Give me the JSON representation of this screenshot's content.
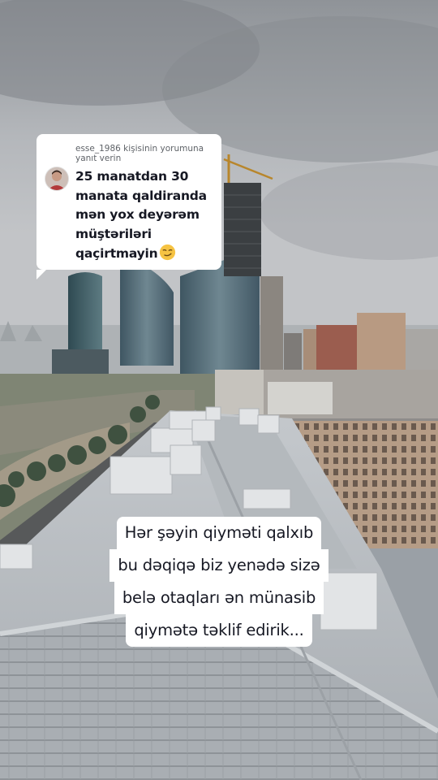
{
  "reply": {
    "header": "esse_1986 kişisinin yorumuna yanıt verin",
    "lines": [
      "25 manatdan 30",
      "manata qaldiranda",
      "mən yox deyərəm",
      "müştəriləri",
      "qaçirtmayin"
    ],
    "emoji_icon": "smirking-face-emoji"
  },
  "caption": {
    "lines": [
      "Hər şəyin qiyməti qalxıb",
      "bu dəqiqə biz yenədə sizə",
      "belə otaqları ən münasib",
      "qiymətə təklif edirik..."
    ]
  },
  "colors": {
    "bubble_bg": "#ffffff",
    "text_primary": "#161823",
    "text_secondary": "#5f6368",
    "sky": "#a9adb1",
    "roof": "#b9bec3"
  }
}
